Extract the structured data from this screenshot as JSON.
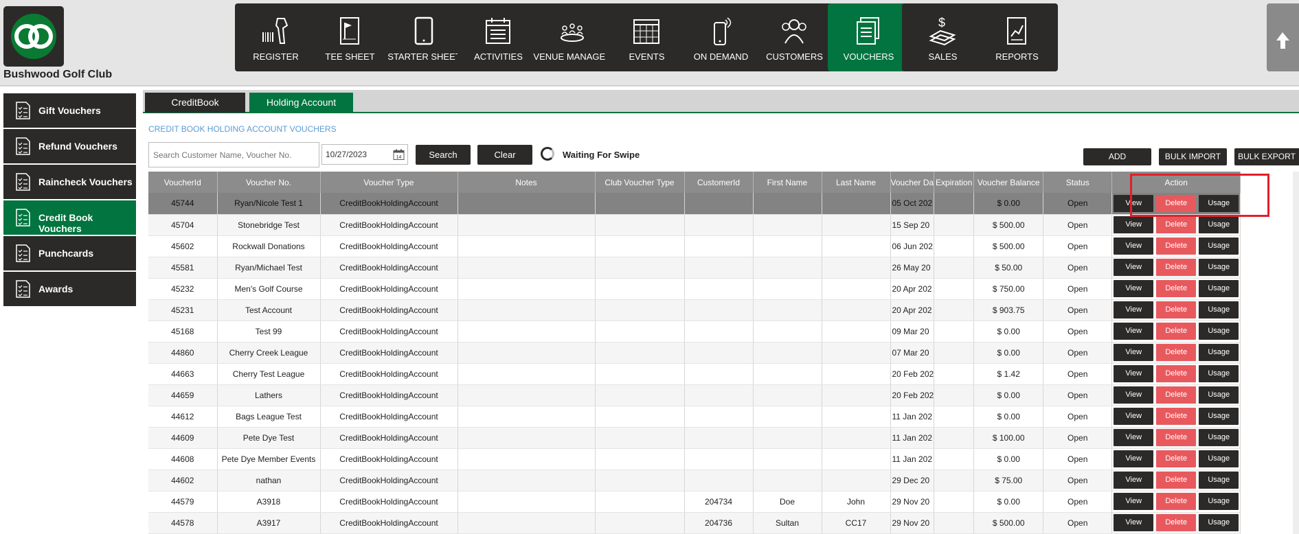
{
  "club": {
    "name": "Bushwood Golf Club"
  },
  "nav": [
    {
      "label": "REGISTER",
      "icon": "barcode-scanner-icon"
    },
    {
      "label": "TEE SHEET",
      "icon": "tee-sheet-icon"
    },
    {
      "label": "STARTER SHEET",
      "icon": "tablet-icon"
    },
    {
      "label": "ACTIVITIES",
      "icon": "calendar-list-icon"
    },
    {
      "label": "VENUE MANAGER",
      "icon": "meeting-table-icon"
    },
    {
      "label": "EVENTS",
      "icon": "calendar-grid-icon"
    },
    {
      "label": "ON DEMAND",
      "icon": "phone-signal-icon"
    },
    {
      "label": "CUSTOMERS",
      "icon": "people-icon"
    },
    {
      "label": "VOUCHERS",
      "icon": "voucher-stack-icon",
      "active": true
    },
    {
      "label": "SALES",
      "icon": "money-stack-icon"
    },
    {
      "label": "REPORTS",
      "icon": "report-chart-icon"
    }
  ],
  "sidebar": [
    {
      "label": "Gift Vouchers"
    },
    {
      "label": "Refund Vouchers"
    },
    {
      "label": "Raincheck Vouchers"
    },
    {
      "label": "Credit Book Vouchers",
      "active": true
    },
    {
      "label": "Punchcards"
    },
    {
      "label": "Awards"
    }
  ],
  "tabs": [
    {
      "label": "CreditBook"
    },
    {
      "label": "Holding Account",
      "active": true
    }
  ],
  "section_title": "CREDIT BOOK HOLDING ACCOUNT VOUCHERS",
  "search": {
    "placeholder": "Search Customer Name, Voucher No.",
    "date": "10/27/2023",
    "search_label": "Search",
    "clear_label": "Clear",
    "swipe_label": "Waiting For Swipe"
  },
  "toolbar": {
    "add": "ADD",
    "bulk_import": "BULK IMPORT",
    "bulk_export": "BULK EXPORT"
  },
  "table": {
    "headers": [
      "VoucherId",
      "Voucher No.",
      "Voucher Type",
      "Notes",
      "Club Voucher Type",
      "CustomerId",
      "First Name",
      "Last Name",
      "Voucher Da",
      "Expiration",
      "Voucher Balance",
      "Status",
      "Action"
    ],
    "actions": {
      "view": "View",
      "delete": "Delete",
      "usage": "Usage"
    },
    "rows": [
      {
        "id": "45744",
        "no": "Ryan/Nicole Test 1",
        "type": "CreditBookHoldingAccount",
        "notes": "",
        "club_type": "",
        "cust": "",
        "first": "",
        "last": "",
        "date": "05 Oct 202",
        "exp": "",
        "bal": "$ 0.00",
        "status": "Open"
      },
      {
        "id": "45704",
        "no": "Stonebridge Test",
        "type": "CreditBookHoldingAccount",
        "notes": "",
        "club_type": "",
        "cust": "",
        "first": "",
        "last": "",
        "date": "15 Sep 20",
        "exp": "",
        "bal": "$ 500.00",
        "status": "Open"
      },
      {
        "id": "45602",
        "no": "Rockwall Donations",
        "type": "CreditBookHoldingAccount",
        "notes": "",
        "club_type": "",
        "cust": "",
        "first": "",
        "last": "",
        "date": "06 Jun 202",
        "exp": "",
        "bal": "$ 500.00",
        "status": "Open"
      },
      {
        "id": "45581",
        "no": "Ryan/Michael Test",
        "type": "CreditBookHoldingAccount",
        "notes": "",
        "club_type": "",
        "cust": "",
        "first": "",
        "last": "",
        "date": "26 May 20",
        "exp": "",
        "bal": "$ 50.00",
        "status": "Open"
      },
      {
        "id": "45232",
        "no": "Men's Golf Course",
        "type": "CreditBookHoldingAccount",
        "notes": "",
        "club_type": "",
        "cust": "",
        "first": "",
        "last": "",
        "date": "20 Apr 202",
        "exp": "",
        "bal": "$ 750.00",
        "status": "Open"
      },
      {
        "id": "45231",
        "no": "Test Account",
        "type": "CreditBookHoldingAccount",
        "notes": "",
        "club_type": "",
        "cust": "",
        "first": "",
        "last": "",
        "date": "20 Apr 202",
        "exp": "",
        "bal": "$ 903.75",
        "status": "Open"
      },
      {
        "id": "45168",
        "no": "Test 99",
        "type": "CreditBookHoldingAccount",
        "notes": "",
        "club_type": "",
        "cust": "",
        "first": "",
        "last": "",
        "date": "09 Mar 20",
        "exp": "",
        "bal": "$ 0.00",
        "status": "Open"
      },
      {
        "id": "44860",
        "no": "Cherry Creek League",
        "type": "CreditBookHoldingAccount",
        "notes": "",
        "club_type": "",
        "cust": "",
        "first": "",
        "last": "",
        "date": "07 Mar 20",
        "exp": "",
        "bal": "$ 0.00",
        "status": "Open"
      },
      {
        "id": "44663",
        "no": "Cherry Test League",
        "type": "CreditBookHoldingAccount",
        "notes": "",
        "club_type": "",
        "cust": "",
        "first": "",
        "last": "",
        "date": "20 Feb 202",
        "exp": "",
        "bal": "$ 1.42",
        "status": "Open"
      },
      {
        "id": "44659",
        "no": "Lathers",
        "type": "CreditBookHoldingAccount",
        "notes": "",
        "club_type": "",
        "cust": "",
        "first": "",
        "last": "",
        "date": "20 Feb 202",
        "exp": "",
        "bal": "$ 0.00",
        "status": "Open"
      },
      {
        "id": "44612",
        "no": "Bags League Test",
        "type": "CreditBookHoldingAccount",
        "notes": "",
        "club_type": "",
        "cust": "",
        "first": "",
        "last": "",
        "date": "11 Jan 202",
        "exp": "",
        "bal": "$ 0.00",
        "status": "Open"
      },
      {
        "id": "44609",
        "no": "Pete Dye Test",
        "type": "CreditBookHoldingAccount",
        "notes": "",
        "club_type": "",
        "cust": "",
        "first": "",
        "last": "",
        "date": "11 Jan 202",
        "exp": "",
        "bal": "$ 100.00",
        "status": "Open"
      },
      {
        "id": "44608",
        "no": "Pete Dye Member Events",
        "type": "CreditBookHoldingAccount",
        "notes": "",
        "club_type": "",
        "cust": "",
        "first": "",
        "last": "",
        "date": "11 Jan 202",
        "exp": "",
        "bal": "$ 0.00",
        "status": "Open"
      },
      {
        "id": "44602",
        "no": "nathan",
        "type": "CreditBookHoldingAccount",
        "notes": "",
        "club_type": "",
        "cust": "",
        "first": "",
        "last": "",
        "date": "29 Dec 20",
        "exp": "",
        "bal": "$ 75.00",
        "status": "Open"
      },
      {
        "id": "44579",
        "no": "A3918",
        "type": "CreditBookHoldingAccount",
        "notes": "",
        "club_type": "",
        "cust": "204734",
        "first": "Doe",
        "last": "John",
        "date": "29 Nov 20",
        "exp": "",
        "bal": "$ 0.00",
        "status": "Open"
      },
      {
        "id": "44578",
        "no": "A3917",
        "type": "CreditBookHoldingAccount",
        "notes": "",
        "club_type": "",
        "cust": "204736",
        "first": "Sultan",
        "last": "CC17",
        "date": "29 Nov 20",
        "exp": "",
        "bal": "$ 500.00",
        "status": "Open"
      }
    ]
  },
  "colors": {
    "brand_green": "#01743f",
    "dark": "#2c2a28",
    "delete_red": "#e8595e",
    "highlight": "#e0202a"
  }
}
